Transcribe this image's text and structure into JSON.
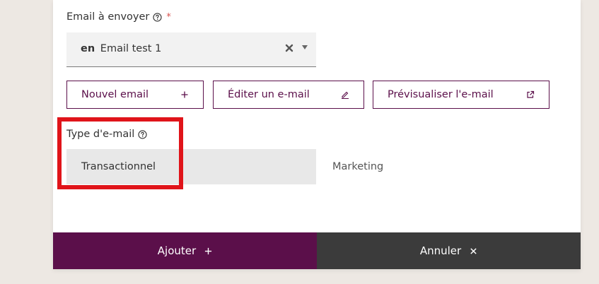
{
  "form": {
    "email_field": {
      "label": "Email à envoyer",
      "required_mark": "*",
      "selected_lang": "en",
      "selected_value": "Email test 1"
    },
    "buttons": {
      "new_email": "Nouvel email",
      "edit_email": "Éditer un e-mail",
      "preview_email": "Prévisualiser l'e-mail"
    },
    "email_type": {
      "label": "Type d'e-mail",
      "options": [
        "Transactionnel",
        "Marketing"
      ],
      "selected": "Transactionnel"
    }
  },
  "footer": {
    "add_label": "Ajouter",
    "cancel_label": "Annuler"
  },
  "colors": {
    "brand": "#5b0f4a",
    "cancel": "#3b3b3b",
    "highlight": "#e0141a",
    "required": "#d9534f"
  },
  "icons": {
    "help": "question-circle-icon",
    "clear": "close-icon",
    "caret": "caret-down-icon",
    "add": "plus-icon",
    "edit": "pencil-icon",
    "external": "external-link-icon",
    "cancel": "close-icon"
  }
}
